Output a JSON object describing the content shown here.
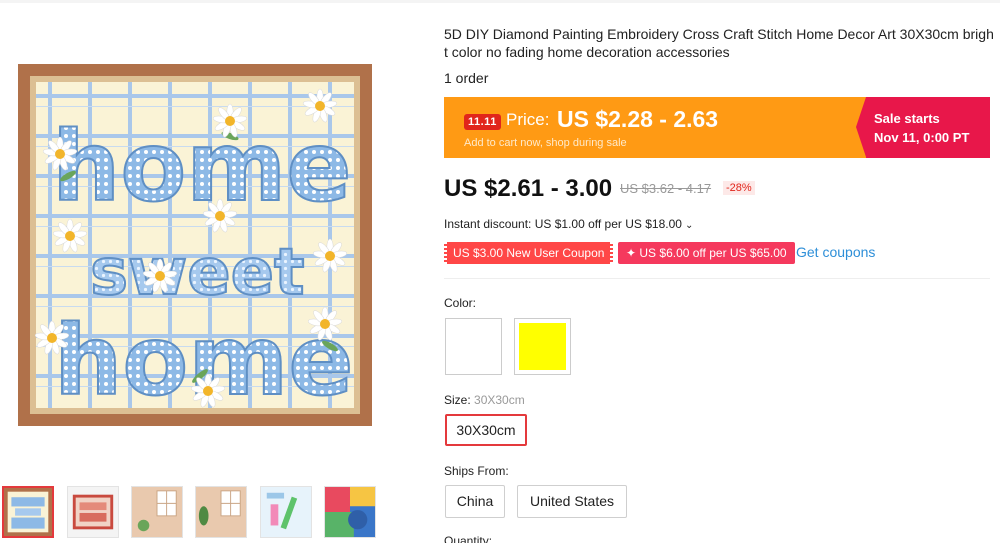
{
  "product": {
    "title": "5D DIY Diamond Painting Embroidery Cross Craft Stitch Home Decor Art 30X30cm bright color no fading home decoration accessories",
    "orders": "1 order"
  },
  "promo": {
    "badge": "11.11",
    "price_label": "Price:",
    "price_range": "US $2.28 - 2.63",
    "subtitle": "Add to cart now, shop during sale",
    "sale_title": "Sale starts",
    "sale_date": "Nov 11, 0:00 PT",
    "colors": {
      "banner": "#ff9a14",
      "sale_box": "#e8174a"
    }
  },
  "pricing": {
    "current": "US $2.61 - 3.00",
    "original": "US $3.62 - 4.17",
    "discount": "-28%"
  },
  "instant_discount": {
    "text": "Instant discount: US $1.00 off per US $18.00",
    "chevron": "⌄"
  },
  "coupons": {
    "new_user": "US $3.00 New User Coupon",
    "store": "✦ US $6.00 off per US $65.00",
    "get_link": "Get coupons"
  },
  "options": {
    "color_label": "Color:",
    "colors": [
      {
        "name": "white",
        "hex": "#ffffff"
      },
      {
        "name": "yellow",
        "hex": "#ffff00"
      }
    ],
    "size_label": "Size:",
    "size_selected": "30X30cm",
    "sizes": [
      "30X30cm"
    ],
    "ships_from_label": "Ships From:",
    "ships_from": [
      "China",
      "United States"
    ],
    "quantity_label": "Quantity:"
  },
  "gallery": {
    "main_image": {
      "title_words": [
        "home",
        "sweet",
        "home"
      ]
    },
    "thumbnails": [
      {
        "name": "home-sweet-home",
        "selected": true
      },
      {
        "name": "frame-variant"
      },
      {
        "name": "wall-mockup"
      },
      {
        "name": "wall-mockup-2"
      },
      {
        "name": "tools-kit"
      },
      {
        "name": "diamond-closeup"
      }
    ]
  }
}
